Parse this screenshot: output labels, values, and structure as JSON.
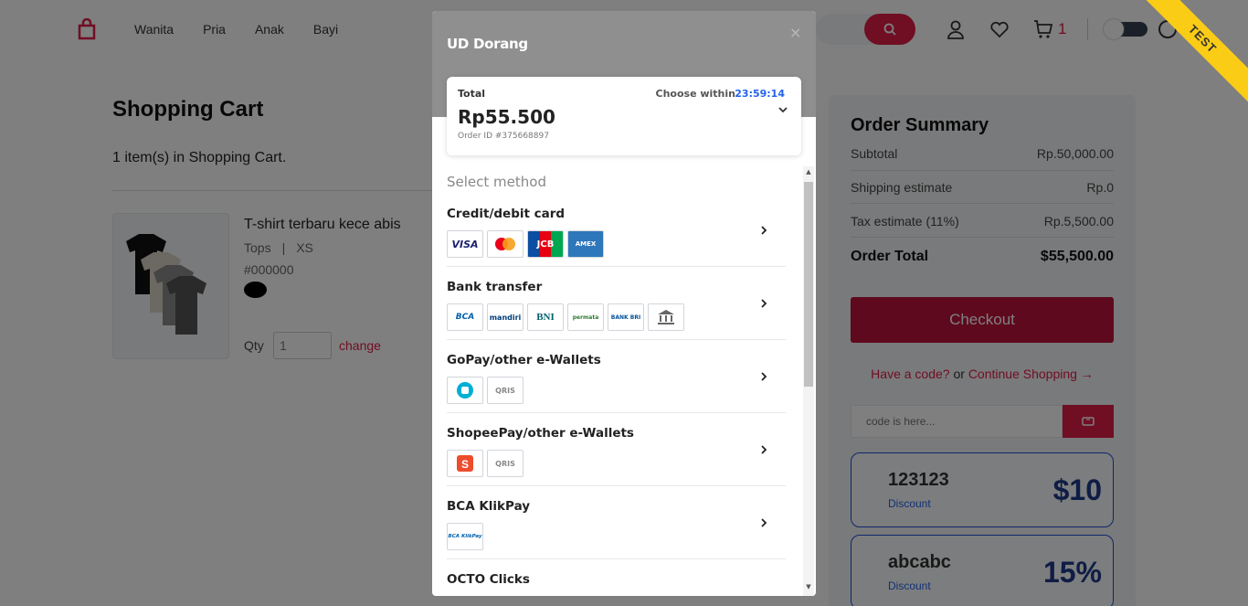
{
  "header": {
    "nav": [
      "Wanita",
      "Pria",
      "Anak",
      "Bayi"
    ],
    "cart_count": "1",
    "ribbon": "TEST",
    "accent": "#e11d48"
  },
  "cart": {
    "title": "Shopping Cart",
    "count_text": "1 item(s) in Shopping Cart.",
    "item": {
      "name": "T-shirt terbaru kece abis",
      "category": "Tops",
      "separator": "|",
      "size": "XS",
      "color_code": "#000000",
      "qty_label": "Qty",
      "qty_value": "1",
      "change_label": "change"
    }
  },
  "summary": {
    "title": "Order Summary",
    "rows": [
      {
        "label": "Subtotal",
        "value": "Rp.50,000.00"
      },
      {
        "label": "Shipping estimate",
        "value": "Rp.0"
      },
      {
        "label": "Tax estimate (11%)",
        "value": "Rp.5,500.00"
      }
    ],
    "total_label": "Order Total",
    "total_value": "$55,500.00",
    "checkout_label": "Checkout",
    "have_code": "Have a code?",
    "or": " or ",
    "continue": "Continue Shopping →",
    "code_placeholder": "code is here...",
    "discounts": [
      {
        "code": "123123",
        "label": "Discount",
        "value": "$10"
      },
      {
        "code": "abcabc",
        "label": "Discount",
        "value": "15%"
      }
    ]
  },
  "modal": {
    "merchant": "UD Dorang",
    "close": "×",
    "total_label": "Total",
    "amount": "Rp55.500",
    "order_id": "Order ID #375668897",
    "choose_within": "Choose within",
    "timer": "23:59:14",
    "select_method": "Select method",
    "methods": [
      {
        "name": "Credit/debit card",
        "logos": [
          "VISA",
          "mastercard",
          "JCB",
          "AMEX"
        ]
      },
      {
        "name": "Bank transfer",
        "logos": [
          "BCA",
          "mandiri",
          "BNI",
          "permata",
          "BANK BRI",
          "bank"
        ]
      },
      {
        "name": "GoPay/other e-Wallets",
        "logos": [
          "gopay",
          "QRIS"
        ]
      },
      {
        "name": "ShopeePay/other e-Wallets",
        "logos": [
          "shopeepay",
          "QRIS"
        ]
      },
      {
        "name": "BCA KlikPay",
        "logos": [
          "BCA KlikPay"
        ]
      },
      {
        "name": "OCTO Clicks",
        "logos": []
      }
    ]
  }
}
